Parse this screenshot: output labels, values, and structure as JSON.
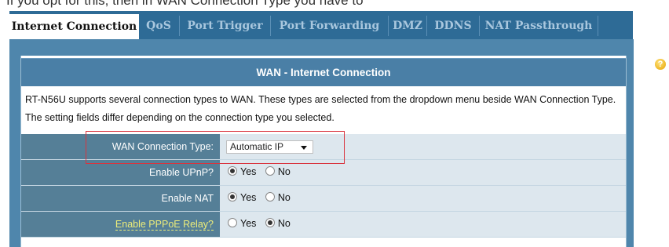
{
  "top_text": "If you opt for this, then in WAN Connection Type you have to",
  "tabs": [
    {
      "label": "Internet Connection"
    },
    {
      "label": "QoS"
    },
    {
      "label": "Port Trigger"
    },
    {
      "label": "Port Forwarding"
    },
    {
      "label": "DMZ"
    },
    {
      "label": "DDNS"
    },
    {
      "label": "NAT Passthrough"
    }
  ],
  "panel": {
    "title": "WAN - Internet Connection",
    "description": "RT-N56U supports several connection types to WAN. These types are selected from the dropdown menu beside WAN Connection Type. The setting fields differ depending on the connection type you selected."
  },
  "fields": {
    "wan_type": {
      "label": "WAN Connection Type:",
      "value": "Automatic IP"
    },
    "upnp": {
      "label": "Enable UPnP?",
      "yes": "Yes",
      "no": "No",
      "selected": "yes"
    },
    "nat": {
      "label": "Enable NAT",
      "yes": "Yes",
      "no": "No",
      "selected": "yes"
    },
    "pppoe": {
      "label": "Enable PPPoE Relay?",
      "yes": "Yes",
      "no": "No",
      "selected": "no"
    }
  },
  "icons": {
    "help": "help-icon"
  },
  "colors": {
    "tab_bar": "#2e6b96",
    "header": "#4a7fa6",
    "label_bg": "#557f97",
    "value_bg": "#dde7ee",
    "highlight": "#d9343e"
  }
}
